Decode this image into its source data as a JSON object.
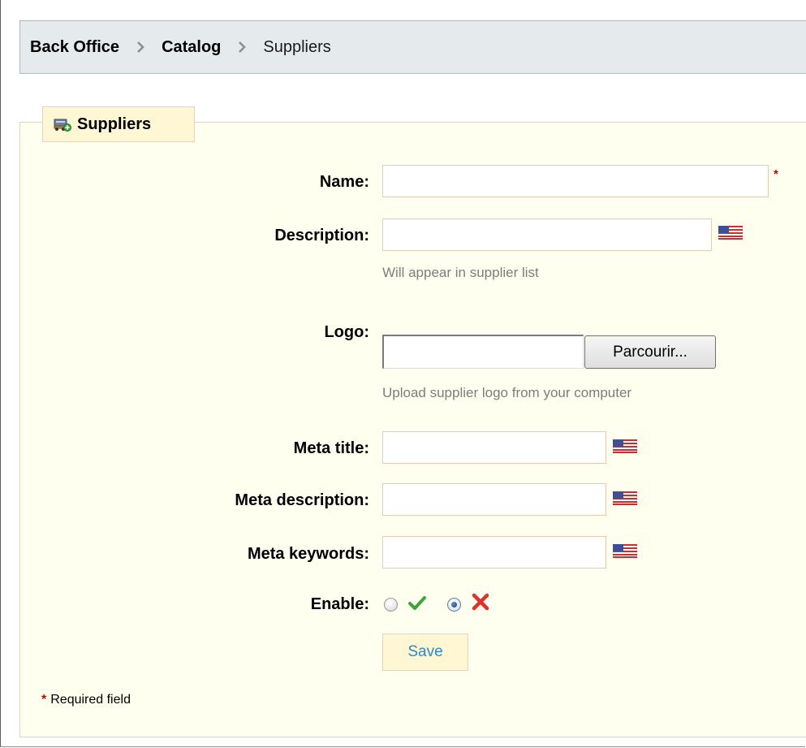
{
  "breadcrumb": {
    "items": [
      "Back Office",
      "Catalog",
      "Suppliers"
    ]
  },
  "legend": {
    "title": "Suppliers",
    "icon": "supplier-icon"
  },
  "form": {
    "name_label": "Name:",
    "name_required_mark": "*",
    "description_label": "Description:",
    "description_hint": "Will appear in supplier list",
    "logo_label": "Logo:",
    "logo_browse_label": "Parcourir...",
    "logo_hint": "Upload supplier logo from your computer",
    "meta_title_label": "Meta title:",
    "meta_description_label": "Meta description:",
    "meta_keywords_label": "Meta keywords:",
    "enable_label": "Enable:",
    "enable_selected": "no",
    "save_label": "Save",
    "language_flag": "us-flag-icon"
  },
  "footer": {
    "required_star": "*",
    "required_note": "Required field"
  },
  "colors": {
    "panel_bg": "#fffff0",
    "breadcrumb_bg": "#e5eaec",
    "save_text": "#268ccd",
    "required": "#cc0000",
    "hint_text": "#7d7d7d"
  }
}
